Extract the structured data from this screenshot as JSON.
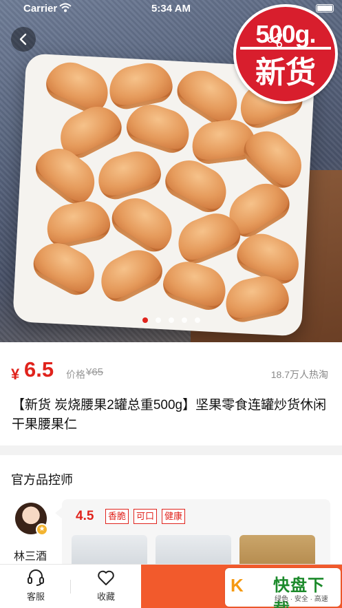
{
  "status_bar": {
    "carrier": "Carrier",
    "time": "5:34 AM"
  },
  "hero": {
    "badge_top": "500g.",
    "badge_bottom": "新货",
    "carousel_dots": 5,
    "active_dot": 0
  },
  "product": {
    "price_symbol": "¥",
    "price": "6.5",
    "original_label": "价格",
    "original_price": "¥65",
    "sales": "18.7万人热淘",
    "title": "【新货 炭烧腰果2罐总重500g】坚果零食连罐炒货休闲干果腰果仁"
  },
  "controller": {
    "heading": "官方品控师",
    "name": "林三酒",
    "score": "4.5",
    "tags": [
      "香脆",
      "可口",
      "健康"
    ]
  },
  "bottom_bar": {
    "service_label": "客服",
    "favorite_label": "收藏"
  },
  "watermark": {
    "title": "快盘下载",
    "subtitle": "绿色 · 安全 · 高速"
  },
  "colors": {
    "accent": "#e0231c",
    "buy": "#f25a2c",
    "badge": "#d81e2d"
  }
}
